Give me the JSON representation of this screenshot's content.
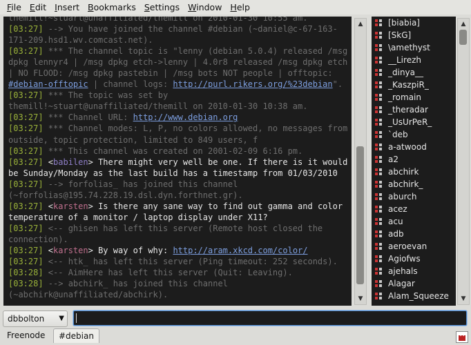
{
  "menu": [
    {
      "pre": "",
      "u": "F",
      "post": "ile"
    },
    {
      "pre": "",
      "u": "E",
      "post": "dit"
    },
    {
      "pre": "",
      "u": "I",
      "post": "nsert"
    },
    {
      "pre": "",
      "u": "B",
      "post": "ookmarks"
    },
    {
      "pre": "",
      "u": "S",
      "post": "ettings"
    },
    {
      "pre": "",
      "u": "W",
      "post": "indow"
    },
    {
      "pre": "",
      "u": "H",
      "post": "elp"
    }
  ],
  "chat": [
    [
      {
        "c": "sys",
        "t": "themill!~stuart@unaffiliated/themill on 2010-01-30 10:55 am."
      }
    ],
    [
      {
        "c": "ts",
        "t": "[03:27]"
      },
      {
        "c": "sys",
        "t": " --> You have joined the channel #debian (~daniel@c-67-163-171-209.hsd1.wv.comcast.net)."
      }
    ],
    [
      {
        "c": "ts",
        "t": "[03:27]"
      },
      {
        "c": "sys",
        "t": " *** The channel topic is \"lenny (debian 5.0.4) released /msg dpkg lennyr4 | /msg dpkg etch->lenny | 4.0r8 released /msg dpkg etch | NO FLOOD: /msg dpkg pastebin | /msg bots NOT people | offtopic: "
      },
      {
        "c": "lnk",
        "t": "#debian-offtopic"
      },
      {
        "c": "sys",
        "t": " | channel logs: "
      },
      {
        "c": "lnk",
        "t": "http://purl.rikers.org/%23debian"
      },
      {
        "c": "sys",
        "t": "\"."
      }
    ],
    [
      {
        "c": "ts",
        "t": "[03:27]"
      },
      {
        "c": "sys",
        "t": " *** The topic was set by themill!~stuart@unaffiliated/themill on 2010-01-30 10:38 am."
      }
    ],
    [
      {
        "c": "ts",
        "t": "[03:27]"
      },
      {
        "c": "sys",
        "t": " *** Channel URL: "
      },
      {
        "c": "lnk",
        "t": "http://www.debian.org"
      }
    ],
    [
      {
        "c": "ts",
        "t": "[03:27]"
      },
      {
        "c": "sys",
        "t": " *** Channel modes: L, P, no colors allowed, no messages from outside, topic protection, limited to 849 users, f"
      }
    ],
    [
      {
        "c": "ts",
        "t": "[03:27]"
      },
      {
        "c": "sys",
        "t": " *** This channel was created on 2001-02-09 6:16 pm."
      }
    ],
    [
      {
        "c": "ts",
        "t": "[03:27]"
      },
      {
        "c": "brk",
        "t": " <"
      },
      {
        "c": "nick-b",
        "t": "babilen"
      },
      {
        "c": "brk",
        "t": ">"
      },
      {
        "c": "msg",
        "t": " There might very well be one. If there is it would be Sunday/Monday as the last build has a timestamp from 01/03/2010"
      }
    ],
    [
      {
        "c": "ts",
        "t": "[03:27]"
      },
      {
        "c": "sys",
        "t": " --> forfolias_ has joined this channel (~forfolias@195.74.228.19.dsl.dyn.forthnet.gr)."
      }
    ],
    [
      {
        "c": "ts",
        "t": "[03:27]"
      },
      {
        "c": "brk",
        "t": " <"
      },
      {
        "c": "nick-k",
        "t": "karsten"
      },
      {
        "c": "brk",
        "t": ">"
      },
      {
        "c": "msg",
        "t": " Is there any sane way to find out gamma and color temperature of a monitor / laptop display under X11?"
      }
    ],
    [
      {
        "c": "ts",
        "t": "[03:27]"
      },
      {
        "c": "sys",
        "t": " <-- ghisen has left this server (Remote host closed the connection)."
      }
    ],
    [
      {
        "c": "ts",
        "t": "[03:27]"
      },
      {
        "c": "brk",
        "t": " <"
      },
      {
        "c": "nick-k",
        "t": "karsten"
      },
      {
        "c": "brk",
        "t": ">"
      },
      {
        "c": "msg",
        "t": " By way of why: "
      },
      {
        "c": "lnk",
        "t": "http://aram.xkcd.com/color/"
      }
    ],
    [
      {
        "c": "ts",
        "t": "[03:27]"
      },
      {
        "c": "sys",
        "t": " <-- htk_ has left this server (Ping timeout: 252 seconds)."
      }
    ],
    [
      {
        "c": "ts",
        "t": "[03:28]"
      },
      {
        "c": "sys",
        "t": " <-- AimHere has left this server (Quit: Leaving)."
      }
    ],
    [
      {
        "c": "ts",
        "t": "[03:28]"
      },
      {
        "c": "sys",
        "t": " --> abchirk_ has joined this channel (~abchirk@unaffiliated/abchirk)."
      }
    ]
  ],
  "nicks": [
    "[biabia]",
    "[SkG]",
    "\\amethyst",
    "__Lirezh",
    "_dinya__",
    "_KaszpiR_",
    "_romain",
    "_theradar",
    "_UsUrPeR_",
    "`deb",
    "a-atwood",
    "a2",
    "abchirk",
    "abchirk_",
    "aburch",
    "acez",
    "acu",
    "adb",
    "aeroevan",
    "Agiofws",
    "ajehals",
    "Alagar",
    "Alam_Squeeze"
  ],
  "input": {
    "nickname": "dbbolton",
    "value": ""
  },
  "tabs": {
    "server": "Freenode",
    "channel": "#debian"
  },
  "colors": {
    "timestamp": "#9ab23a",
    "system": "#6e6e6e",
    "link": "#7d9fe0",
    "background": "#1c1c1c"
  }
}
